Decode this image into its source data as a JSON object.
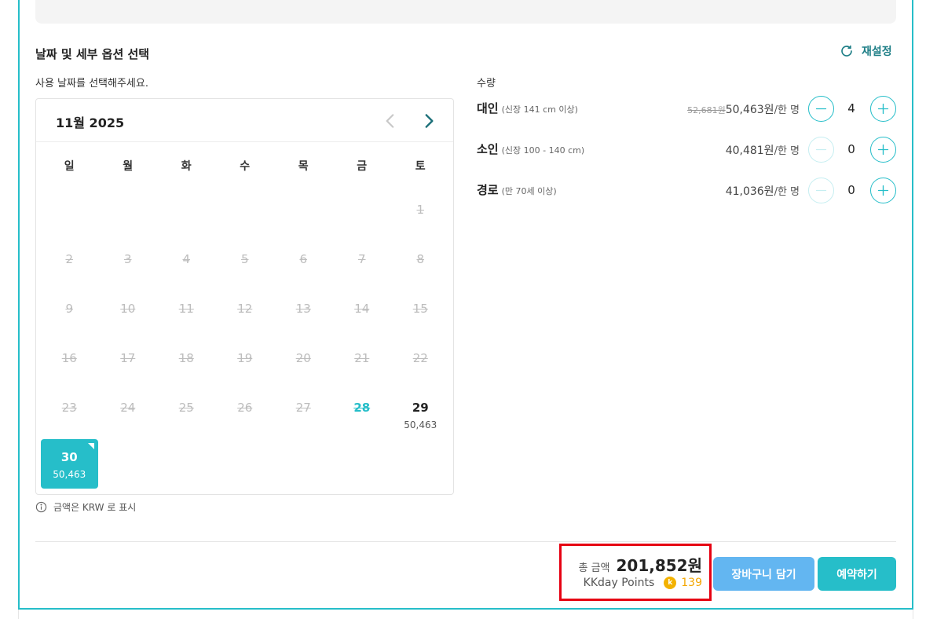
{
  "section": {
    "title": "날짜 및 세부 옵션 선택",
    "reset_label": "재설정",
    "date_prompt": "사용 날짜를 선택해주세요."
  },
  "calendar": {
    "month_label": "11월 2025",
    "weekdays": [
      "일",
      "월",
      "화",
      "수",
      "목",
      "금",
      "토"
    ],
    "days": [
      {
        "num": "",
        "state": "empty",
        "price": ""
      },
      {
        "num": "",
        "state": "empty",
        "price": ""
      },
      {
        "num": "",
        "state": "empty",
        "price": ""
      },
      {
        "num": "",
        "state": "empty",
        "price": ""
      },
      {
        "num": "",
        "state": "empty",
        "price": ""
      },
      {
        "num": "",
        "state": "empty",
        "price": ""
      },
      {
        "num": "1",
        "state": "disabled",
        "price": ""
      },
      {
        "num": "2",
        "state": "disabled",
        "price": ""
      },
      {
        "num": "3",
        "state": "disabled",
        "price": ""
      },
      {
        "num": "4",
        "state": "disabled",
        "price": ""
      },
      {
        "num": "5",
        "state": "disabled",
        "price": ""
      },
      {
        "num": "6",
        "state": "disabled",
        "price": ""
      },
      {
        "num": "7",
        "state": "disabled",
        "price": ""
      },
      {
        "num": "8",
        "state": "disabled",
        "price": ""
      },
      {
        "num": "9",
        "state": "disabled",
        "price": ""
      },
      {
        "num": "10",
        "state": "disabled",
        "price": ""
      },
      {
        "num": "11",
        "state": "disabled",
        "price": ""
      },
      {
        "num": "12",
        "state": "disabled",
        "price": ""
      },
      {
        "num": "13",
        "state": "disabled",
        "price": ""
      },
      {
        "num": "14",
        "state": "disabled",
        "price": ""
      },
      {
        "num": "15",
        "state": "disabled",
        "price": ""
      },
      {
        "num": "16",
        "state": "disabled",
        "price": ""
      },
      {
        "num": "17",
        "state": "disabled",
        "price": ""
      },
      {
        "num": "18",
        "state": "disabled",
        "price": ""
      },
      {
        "num": "19",
        "state": "disabled",
        "price": ""
      },
      {
        "num": "20",
        "state": "disabled",
        "price": ""
      },
      {
        "num": "21",
        "state": "disabled",
        "price": ""
      },
      {
        "num": "22",
        "state": "disabled",
        "price": ""
      },
      {
        "num": "23",
        "state": "disabled",
        "price": ""
      },
      {
        "num": "24",
        "state": "disabled",
        "price": ""
      },
      {
        "num": "25",
        "state": "disabled",
        "price": ""
      },
      {
        "num": "26",
        "state": "disabled",
        "price": ""
      },
      {
        "num": "27",
        "state": "disabled",
        "price": ""
      },
      {
        "num": "28",
        "state": "teal",
        "price": ""
      },
      {
        "num": "29",
        "state": "available",
        "price": "50,463"
      },
      {
        "num": "30",
        "state": "selected",
        "price": "50,463"
      }
    ]
  },
  "currency_note": "금액은 KRW 로 표시",
  "quantity": {
    "label": "수량",
    "rows": [
      {
        "name": "대인",
        "condition": "(신장 141 cm 이상)",
        "old_price": "52,681원",
        "price": "50,463원",
        "unit": "/한 명",
        "count": "4",
        "minus_disabled": false
      },
      {
        "name": "소인",
        "condition": "(신장 100 - 140 cm)",
        "old_price": "",
        "price": "40,481원",
        "unit": "/한 명",
        "count": "0",
        "minus_disabled": true
      },
      {
        "name": "경로",
        "condition": "(만 70세 이상)",
        "old_price": "",
        "price": "41,036원",
        "unit": "/한 명",
        "count": "0",
        "minus_disabled": true
      }
    ]
  },
  "total": {
    "label": "총 금액",
    "amount": "201,852원",
    "points_label": "KKday Points",
    "points_icon": "k-coin-icon",
    "points_value": "139"
  },
  "buttons": {
    "cart": "장바구니 담기",
    "book": "예약하기"
  },
  "colors": {
    "accent": "#26bec9",
    "cart_button": "#63b6f1",
    "highlight_box": "#e60012",
    "points": "#f3a600"
  }
}
